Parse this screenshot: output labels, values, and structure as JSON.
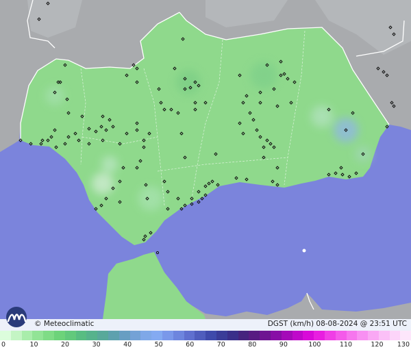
{
  "map": {
    "brand": "© Meteoclimatic",
    "title": "DGST (km/h)   08-08-2024 @ 23:51 UTC",
    "colors": {
      "sea": "#7b84dc",
      "land_outside": "#a9abae",
      "land_region": "#8fd98c",
      "border": "#ffffff",
      "station": "#111111"
    },
    "icons": [
      "meteoclimatic-logo-icon",
      "station-marker-icon"
    ]
  },
  "scale": {
    "labels": [
      "0",
      "10",
      "20",
      "30",
      "40",
      "50",
      "60",
      "70",
      "80",
      "90",
      "100",
      "110",
      "120",
      "130"
    ],
    "colors": [
      "#dcfddc",
      "#c4f5c4",
      "#a9edab",
      "#92e496",
      "#7fdc86",
      "#6dd37a",
      "#62c97c",
      "#58bd82",
      "#56b38c",
      "#58a99a",
      "#5da1ae",
      "#679ec2",
      "#74a2d6",
      "#7fa8e8",
      "#84aaf2",
      "#7a98ea",
      "#6d85de",
      "#5f70cf",
      "#4f5dbd",
      "#3f4aab",
      "#3a3c98",
      "#3a2f8a",
      "#46237e",
      "#581b82",
      "#6e1491",
      "#880ea6",
      "#a40ab8",
      "#bf08ca",
      "#d80ad8",
      "#e81ee0",
      "#f03ee6",
      "#f45aea",
      "#f676ee",
      "#f890f2",
      "#f9a8f4",
      "#fbc0f7",
      "#fcd4f9",
      "#fde6fb"
    ]
  }
}
